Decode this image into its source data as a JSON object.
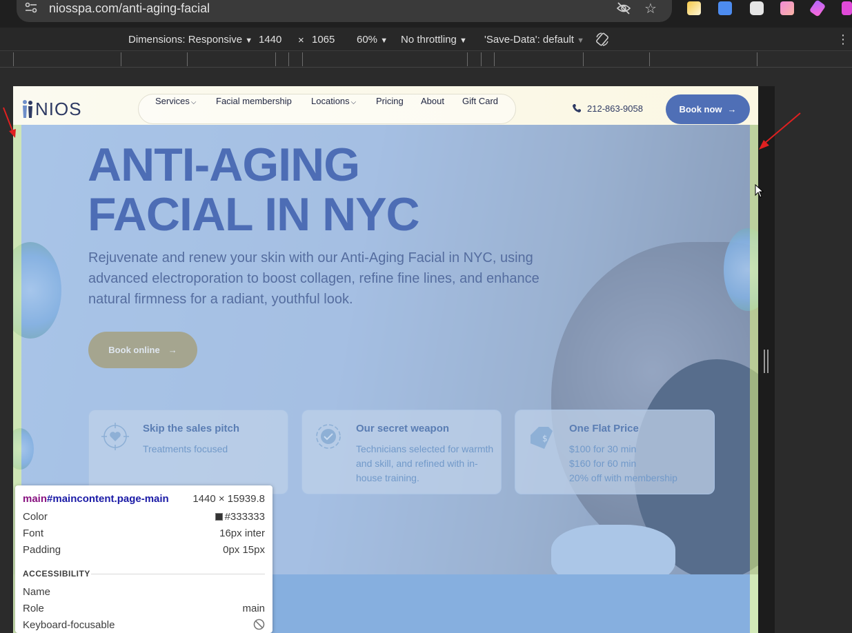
{
  "browser": {
    "url": "niosspa.com/anti-aging-facial"
  },
  "device_toolbar": {
    "dimensions_label": "Dimensions: Responsive",
    "width": "1440",
    "times": "×",
    "height": "1065",
    "zoom": "60%",
    "throttling": "No throttling",
    "save_data": "'Save-Data': default",
    "dropdown_glyph": "▼"
  },
  "site": {
    "logo_text": "NIOS",
    "nav": [
      {
        "label": "Services",
        "has_dropdown": true
      },
      {
        "label": "Facial membership",
        "has_dropdown": false
      },
      {
        "label": "Locations",
        "has_dropdown": true
      },
      {
        "label": "Pricing",
        "has_dropdown": false
      },
      {
        "label": "About",
        "has_dropdown": false
      },
      {
        "label": "Gift Card",
        "has_dropdown": false
      }
    ],
    "phone": "212-863-9058",
    "book_now": "Book now",
    "arrow_glyph": "→"
  },
  "hero": {
    "title_line1": "ANTI-AGING",
    "title_line2": "FACIAL IN NYC",
    "subtitle": "Rejuvenate and renew your skin with our Anti-Aging Facial in NYC, using advanced electroporation to boost collagen, refine fine lines, and enhance natural firmness for a radiant, youthful look.",
    "cta": "Book online"
  },
  "features": [
    {
      "title": "Skip the sales pitch",
      "text": "Treatments focused",
      "icon": "heart-target-icon"
    },
    {
      "title": "Our secret weapon",
      "text": "Technicians selected for warmth and skill, and refined with in-house training.",
      "icon": "badge-check-icon"
    },
    {
      "title": "One Flat Price",
      "text": "$100 for 30 min\n$160 for 60 min\n20% off with membership",
      "icon": "price-tag-icon"
    }
  ],
  "inspect_tooltip": {
    "tag": "main",
    "selector": "#maincontent.page-main",
    "size": "1440 × 15939.8",
    "rows": [
      {
        "key": "Color",
        "value": "#333333"
      },
      {
        "key": "Font",
        "value": "16px inter"
      },
      {
        "key": "Padding",
        "value": "0px 15px"
      }
    ],
    "section": "ACCESSIBILITY",
    "a11y_rows": [
      {
        "key": "Name",
        "value": ""
      },
      {
        "key": "Role",
        "value": "main"
      },
      {
        "key": "Keyboard-focusable",
        "value": ""
      }
    ]
  },
  "colors": {
    "brand_blue": "#4f6fb6",
    "highlight_content": "#6fa0dc",
    "highlight_padding": "#c3e1a0",
    "annotation_red": "#e02020"
  }
}
